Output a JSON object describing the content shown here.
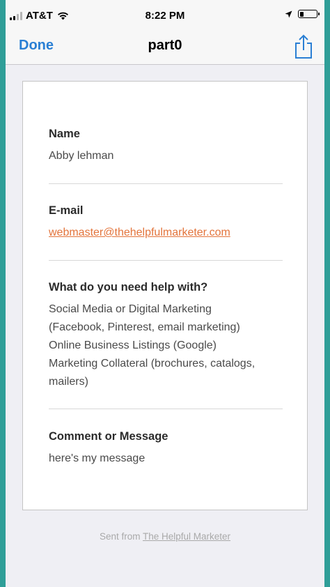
{
  "status_bar": {
    "carrier": "AT&T",
    "time": "8:22 PM"
  },
  "nav": {
    "done_label": "Done",
    "title": "part0"
  },
  "form": {
    "name": {
      "label": "Name",
      "value": "Abby lehman"
    },
    "email": {
      "label": "E-mail",
      "value": "webmaster@thehelpfulmarketer.com"
    },
    "help": {
      "label": "What do you need help with?",
      "lines": [
        "Social Media or Digital Marketing",
        "(Facebook, Pinterest, email marketing)",
        "Online Business Listings (Google)",
        "Marketing Collateral (brochures, catalogs,",
        "mailers)"
      ]
    },
    "comment": {
      "label": "Comment or Message",
      "value": "here's my message"
    }
  },
  "footer": {
    "prefix": "Sent from",
    "link": "The Helpful Marketer"
  },
  "colors": {
    "accent": "#2a7fd4",
    "link": "#e3743b",
    "frame": "#2f9e98"
  },
  "icons": [
    "signal-bars-icon",
    "wifi-icon",
    "location-arrow-icon",
    "battery-icon",
    "share-icon"
  ]
}
